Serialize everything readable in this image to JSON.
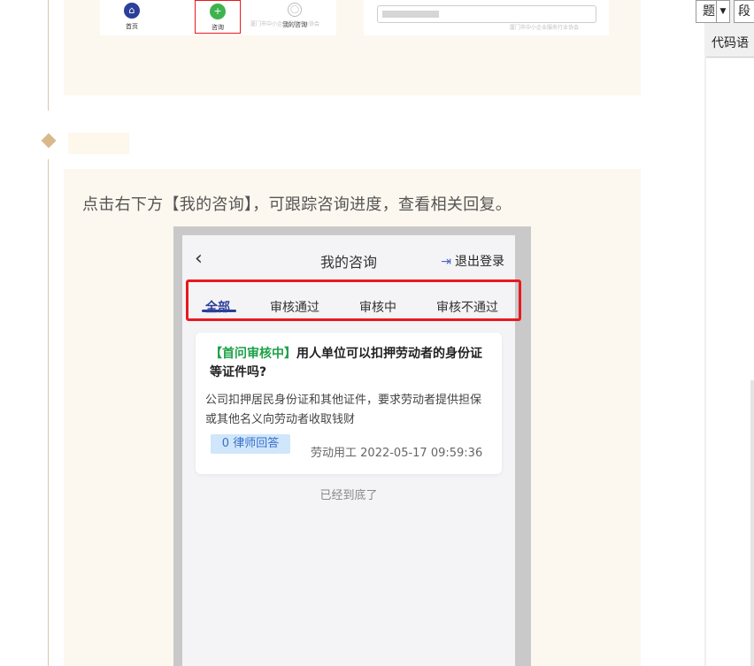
{
  "top_card": {
    "mini_tabs": [
      {
        "label": "首页",
        "icon": "home-icon",
        "color": "#2c3f9a"
      },
      {
        "label": "咨询",
        "icon": "plus-icon",
        "color": "#3fb34f"
      },
      {
        "label": "我的咨询",
        "icon": "user-icon",
        "color": "#bbbbbb"
      }
    ],
    "watermark": "厦门市中小企业服务行业协会"
  },
  "section": {
    "intro": "点击右下方【我的咨询】，可跟踪咨询进度，查看相关回复。"
  },
  "phone": {
    "back_icon": "chevron-left-icon",
    "title": "我的咨询",
    "logout_label": "退出登录",
    "logout_icon": "logout-icon",
    "tabs": [
      "全部",
      "审核通过",
      "审核中",
      "审核不通过"
    ],
    "active_tab": "全部",
    "items": [
      {
        "status_tag": "【首问审核中】",
        "question": "用人单位可以扣押劳动者的身份证等证件吗?",
        "description": "公司扣押居民身份证和其他证件，要求劳动者提供担保或其他名义向劳动者收取钱财",
        "answers_badge": "0 律师回答",
        "category": "劳动用工",
        "timestamp": "2022-05-17 09:59:36"
      }
    ],
    "end_text": "已经到底了"
  },
  "editor_toolbar": {
    "combo_fragment": "题",
    "combo_arrow": "chevron-down-icon",
    "paragraph_fragment": "段",
    "code_fragment": "代码语"
  },
  "colors": {
    "card_bg": "#fdf8ef",
    "accent_blue": "#2c3f9a",
    "status_green": "#1ea148",
    "highlight_red": "#e8191f"
  }
}
